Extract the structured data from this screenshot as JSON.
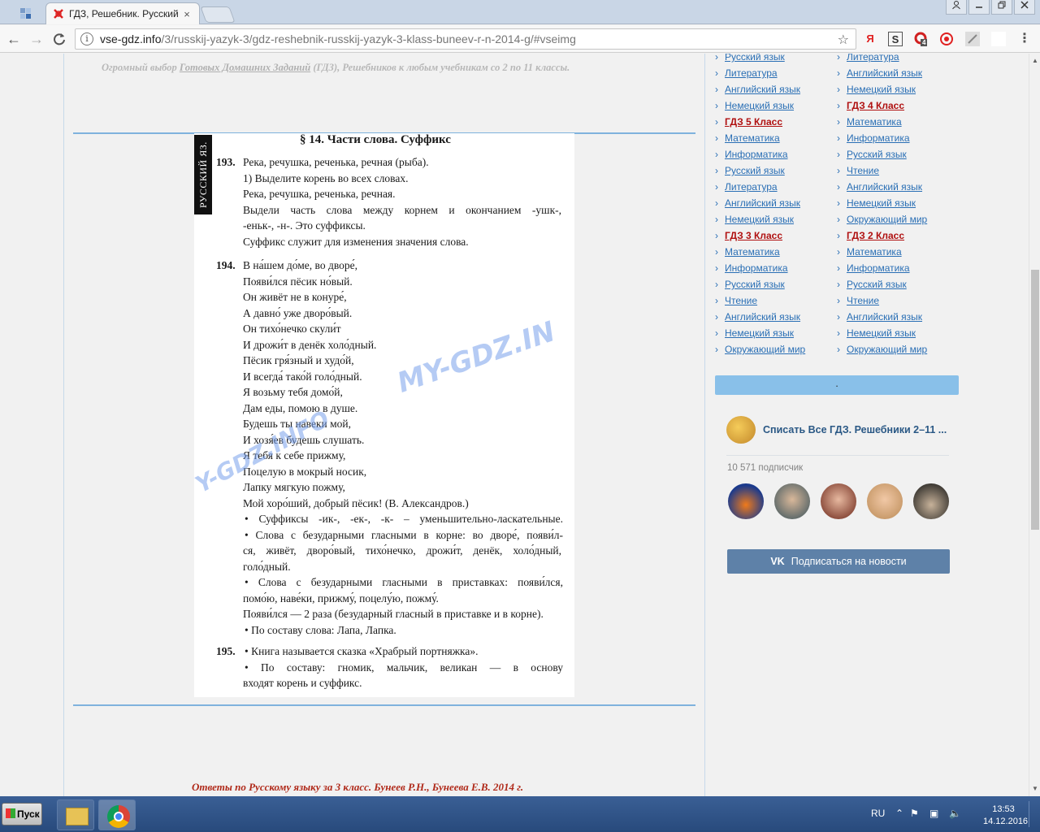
{
  "browser": {
    "tab_title": "ГДЗ, Решебник. Русский я",
    "tab_close": "×",
    "url_host": "vse-gdz.info",
    "url_path": "/3/russkij-yazyk-3/gdz-reshebnik-russkij-yazyk-3-klass-buneev-r-n-2014-g/#vseimg",
    "info_glyph": "i",
    "back": "←",
    "forward": "→",
    "reload": "C",
    "star": "☆",
    "ext_yandex": "Я",
    "ext_s": "S",
    "ext_badge": "4",
    "menu": "⋮"
  },
  "page": {
    "promo_prefix": "Огромный выбор ",
    "promo_link": "Готовых Домашних Заданий",
    "promo_suffix": " (ГДЗ), Решебников к любым учебникам со 2 по 11 классы.",
    "footer_credit": "Ответы по Русскому языку за 3 класс. Бунеев Р.Н., Бунеева Е.В. 2014 г."
  },
  "scan": {
    "side_label": "РУССКИЙ ЯЗ.",
    "title": "§ 14. Части слова. Суффикс",
    "watermark_main": "MY-GDZ.IN",
    "watermark_left": "Y-GDZ.INFO",
    "ex193": {
      "num": "193.",
      "lines": [
        "Река, речушка, реченька, речная (рыба).",
        "1) Выделите корень во всех словах.",
        "Река, речушка, реченька, речная.",
        "Выдели часть слова между корнем и окончанием -ушк-,",
        "-еньк-, -н-. Это суффиксы.",
        "Суффикс служит для изменения значения слова."
      ]
    },
    "ex194": {
      "num": "194.",
      "lines": [
        "В на́шем до́ме, во дворе́,",
        "Появи́лся пёсик но́вый.",
        "Он живёт не в конуре́,",
        "А давно́ уже дворо́вый.",
        "Он тихо́нечко скули́т",
        "И дрожи́т в денёк холо́дный.",
        "Пёсик гря́зный и худо́й,",
        "И всегда́ тако́й голо́дный.",
        "Я возьму тебя домо́й,",
        "Дам еды, помою в душе.",
        "Будешь ты навеки мой,",
        "И хозя́ев будешь слушать.",
        "Я тебя к себе прижму,",
        "Поцелую в мокрый носик,",
        "Лапку мягкую пожму,",
        "Мой хоро́ший, добрый пёсик! (В. Александров.)",
        "•  Суффиксы -ик-, -ек-, -к- – уменьшительно-ласкательные.",
        "•  Слова с безударными гласными в корне: во дворе́, появи́л-",
        "ся, живёт, дворо́вый, тихо́нечко, дрожи́т, денёк, холо́дный,",
        "голо́дный.",
        "•  Слова с безударными гласными в приставках: появи́лся,",
        "помо́ю, наве́ки, прижму́, поцелу́ю, пожму́.",
        "Появи́лся — 2 раза (безударный гласный в приставке и в корне).",
        "•  По составу слова: Лапа, Лапка."
      ]
    },
    "ex195": {
      "num": "195.",
      "lines": [
        "•  Книга называется сказка «Храбрый портняжка».",
        "•  По составу: гномик, мальчик, великан — в основу",
        "входят корень и суффикс."
      ]
    }
  },
  "sidebar": {
    "col1": [
      {
        "label": "Русский язык",
        "hl": false
      },
      {
        "label": "Литература",
        "hl": false
      },
      {
        "label": "Английский язык",
        "hl": false
      },
      {
        "label": "Немецкий язык",
        "hl": false
      },
      {
        "label": "ГДЗ 5 Класс",
        "hl": true
      },
      {
        "label": "Математика",
        "hl": false
      },
      {
        "label": "Информатика",
        "hl": false
      },
      {
        "label": "Русский язык",
        "hl": false
      },
      {
        "label": "Литература",
        "hl": false
      },
      {
        "label": "Английский язык",
        "hl": false
      },
      {
        "label": "Немецкий язык",
        "hl": false
      },
      {
        "label": "ГДЗ 3 Класс",
        "hl": true
      },
      {
        "label": "Математика",
        "hl": false
      },
      {
        "label": "Информатика",
        "hl": false
      },
      {
        "label": "Русский язык",
        "hl": false
      },
      {
        "label": "Чтение",
        "hl": false
      },
      {
        "label": "Английский язык",
        "hl": false
      },
      {
        "label": "Немецкий язык",
        "hl": false
      },
      {
        "label": "Окружающий мир",
        "hl": false
      }
    ],
    "col2": [
      {
        "label": "Литература",
        "hl": false
      },
      {
        "label": "Английский язык",
        "hl": false
      },
      {
        "label": "Немецкий язык",
        "hl": false
      },
      {
        "label": "ГДЗ 4 Класс",
        "hl": true
      },
      {
        "label": "Математика",
        "hl": false
      },
      {
        "label": "Информатика",
        "hl": false
      },
      {
        "label": "Русский язык",
        "hl": false
      },
      {
        "label": "Чтение",
        "hl": false
      },
      {
        "label": "Английский язык",
        "hl": false
      },
      {
        "label": "Немецкий язык",
        "hl": false
      },
      {
        "label": "Окружающий мир",
        "hl": false
      },
      {
        "label": "ГДЗ 2 Класс",
        "hl": true
      },
      {
        "label": "Математика",
        "hl": false
      },
      {
        "label": "Информатика",
        "hl": false
      },
      {
        "label": "Русский язык",
        "hl": false
      },
      {
        "label": "Чтение",
        "hl": false
      },
      {
        "label": "Английский язык",
        "hl": false
      },
      {
        "label": "Немецкий язык",
        "hl": false
      },
      {
        "label": "Окружающий мир",
        "hl": false
      }
    ],
    "blue_bar_text": ".",
    "vk": {
      "group_name": "Списать Все ГДЗ. Решебники 2–11 ...",
      "subscribers": "10 571 подписчик",
      "button_logo": "VK",
      "button_label": "Подписаться на новости"
    }
  },
  "taskbar": {
    "start_label": "Пуск",
    "lang": "RU",
    "time": "13:53",
    "date": "14.12.2016"
  },
  "colors": {
    "link": "#2a6fb5",
    "link_highlight": "#b01010",
    "divider": "#7fb2dd",
    "vk_button": "#5e81a8",
    "credit": "#b02a1a"
  }
}
